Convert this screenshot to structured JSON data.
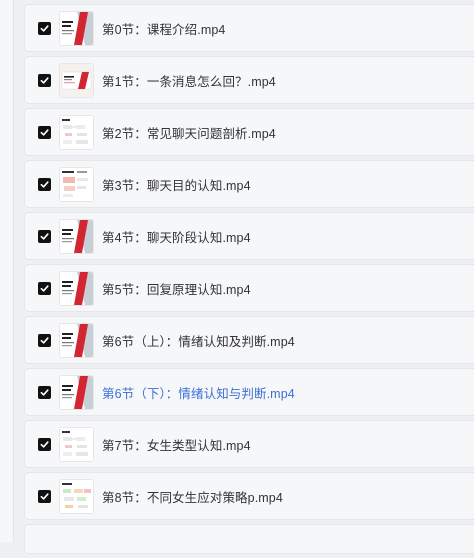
{
  "playlist": {
    "items": [
      {
        "title": "第0节：课程介绍.mp4",
        "checked": true,
        "active": false,
        "thumb": "red-slash"
      },
      {
        "title": "第1节：一条消息怎么回？.mp4",
        "checked": true,
        "active": false,
        "thumb": "slide-wide"
      },
      {
        "title": "第2节：常见聊天问题剖析.mp4",
        "checked": true,
        "active": false,
        "thumb": "mindmap"
      },
      {
        "title": "第3节：聊天目的认知.mp4",
        "checked": true,
        "active": false,
        "thumb": "mindmap-red"
      },
      {
        "title": "第4节：聊天阶段认知.mp4",
        "checked": true,
        "active": false,
        "thumb": "red-slash"
      },
      {
        "title": "第5节：回复原理认知.mp4",
        "checked": true,
        "active": false,
        "thumb": "red-slash"
      },
      {
        "title": "第6节（上）：情绪认知及判断.mp4",
        "checked": true,
        "active": false,
        "thumb": "red-slash"
      },
      {
        "title": "第6节（下）：情绪认知与判断.mp4",
        "checked": true,
        "active": true,
        "thumb": "red-slash"
      },
      {
        "title": "第7节：女生类型认知.mp4",
        "checked": true,
        "active": false,
        "thumb": "mindmap"
      },
      {
        "title": "第8节：不同女生应对策略p.mp4",
        "checked": true,
        "active": false,
        "thumb": "mindmap-green"
      }
    ]
  },
  "colors": {
    "accent": "#3b6fd6",
    "brand_red": "#d22632",
    "checkbox": "#111111"
  },
  "icons": {
    "checkbox": "check-icon"
  }
}
